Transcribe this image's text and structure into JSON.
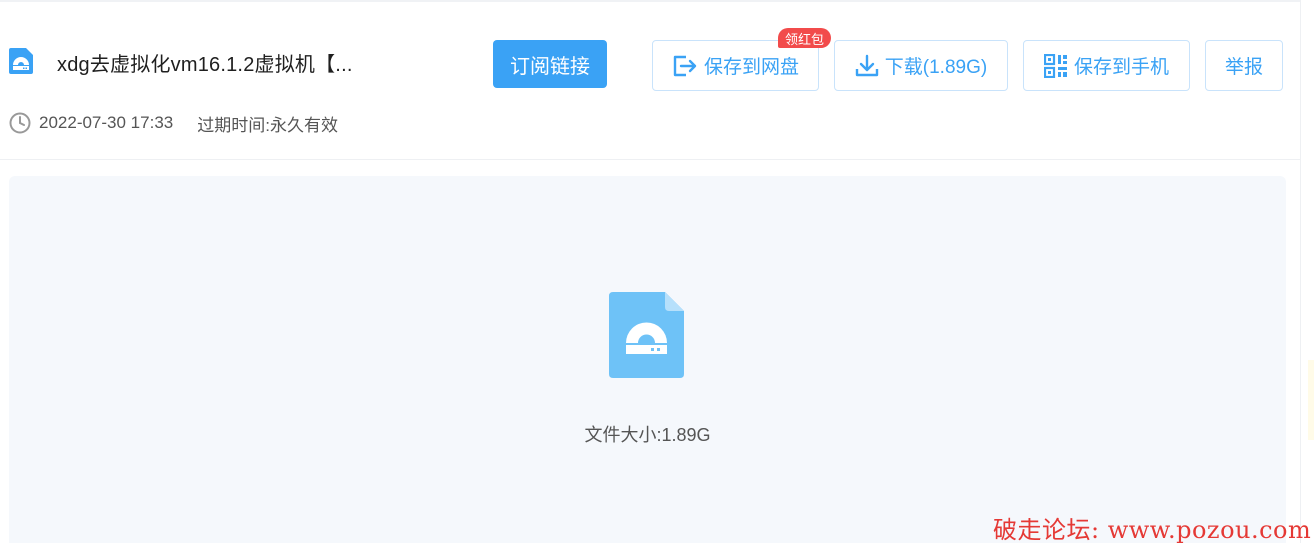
{
  "file": {
    "title": "xdg去虚拟化vm16.1.2虚拟机【...",
    "icon": "disk-image-icon",
    "date": "2022-07-30 17:33",
    "expire_label": "过期时间:",
    "expire_value": "永久有效"
  },
  "toolbar": {
    "subscribe_label": "订阅链接",
    "save_label": "保存到网盘",
    "save_badge": "领红包",
    "download_label": "下载(1.89G)",
    "phone_label": "保存到手机",
    "report_label": "举报"
  },
  "preview": {
    "size_text": "文件大小:1.89G"
  },
  "watermark": "破走论坛: www.pozou.com",
  "colors": {
    "accent": "#3aa2f5",
    "badge": "#f24b4b",
    "icon_blue": "#6ec2f7",
    "panel_bg": "#f5f8fc",
    "watermark": "#e53935"
  }
}
